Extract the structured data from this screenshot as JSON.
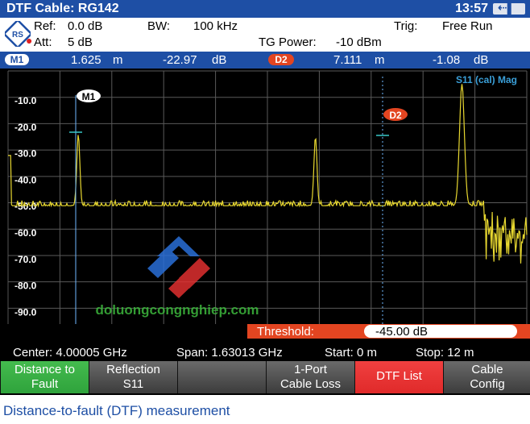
{
  "title": "DTF  Cable: RG142",
  "clock": "13:57",
  "battery_icon": "battery-plug-icon",
  "info": {
    "ref_label": "Ref:",
    "ref_value": "0.0 dB",
    "att_label": "Att:",
    "att_value": "5 dB",
    "bw_label": "BW:",
    "bw_value": "100 kHz",
    "trig_label": "Trig:",
    "trig_value": "Free Run",
    "tg_label": "TG Power:",
    "tg_value": "-10 dBm"
  },
  "markers": {
    "m1": {
      "label": "M1",
      "position": "1.625",
      "position_unit": "m",
      "level": "-22.97",
      "level_unit": "dB"
    },
    "d2": {
      "label": "D2",
      "position": "7.111",
      "position_unit": "m",
      "level": "-1.08",
      "level_unit": "dB"
    }
  },
  "trace_label": "S11 (cal) Mag",
  "y_ticks": [
    "-10.0",
    "-20.0",
    "-30.0",
    "-40.0",
    "-50.0",
    "-60.0",
    "-70.0",
    "-80.0",
    "-90.0"
  ],
  "threshold": {
    "label": "Threshold:",
    "value": "-45.00 dB"
  },
  "freq": {
    "center": "Center: 4.00005 GHz",
    "span": "Span:  1.63013 GHz",
    "start": "Start:  0 m",
    "stop": "Stop:   12 m"
  },
  "softkeys": [
    {
      "line1": "Distance to",
      "line2": "Fault",
      "state": "active"
    },
    {
      "line1": "Reflection",
      "line2": "S11",
      "state": "normal"
    },
    {
      "line1": "",
      "line2": "",
      "state": "normal"
    },
    {
      "line1": "1-Port",
      "line2": "Cable Loss",
      "state": "normal"
    },
    {
      "line1": "DTF List",
      "line2": "",
      "state": "highlight"
    },
    {
      "line1": "Cable",
      "line2": "Config",
      "state": "normal"
    }
  ],
  "watermark": "doluongcongnghiep.com",
  "caption": "Distance-to-fault (DTF) measurement",
  "colors": {
    "brand_blue": "#1e4fa5",
    "trace": "#e8d830",
    "threshold_red": "#e34521",
    "softkey_green": "#2fa33c",
    "softkey_red": "#e02a2a"
  }
}
